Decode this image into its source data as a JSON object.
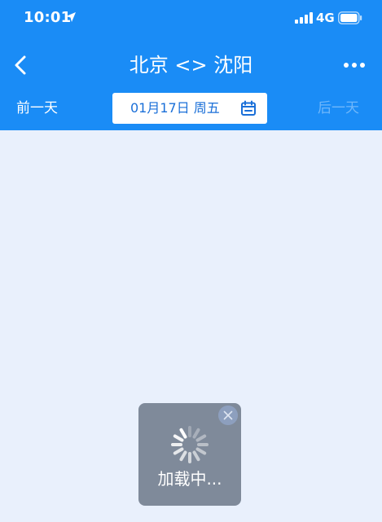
{
  "status_bar": {
    "time": "10:01",
    "network": "4G",
    "icons": [
      "location-arrow-icon",
      "signal-icon",
      "battery-icon"
    ]
  },
  "nav": {
    "title": "北京 <> 沈阳",
    "icons": [
      "chevron-left-icon",
      "more-dots-icon"
    ]
  },
  "date_bar": {
    "prev_label": "前一天",
    "date_label": "01月17日 周五",
    "next_label": "后一天",
    "icon": "calendar-icon"
  },
  "loading": {
    "text": "加载中...",
    "icons": [
      "spinner-icon",
      "close-icon"
    ]
  },
  "colors": {
    "header_blue": "#1a8cf6",
    "page_bg": "#e9f0fc",
    "date_text": "#1a6fd8",
    "next_day_disabled": "#6fb7fb",
    "toast_bg": "#7f8a9a"
  }
}
